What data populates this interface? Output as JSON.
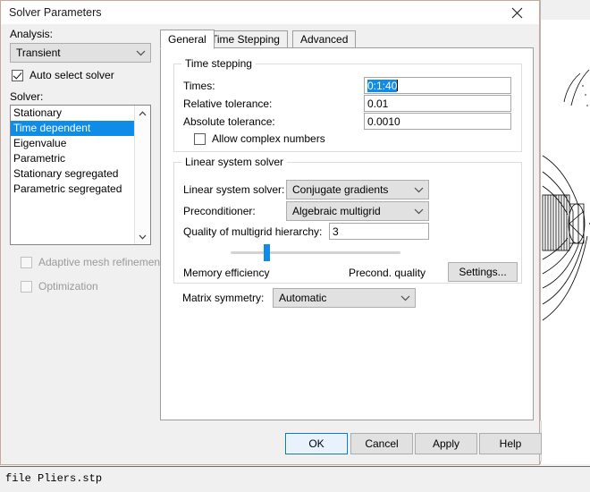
{
  "app": {
    "status_text": "file Pliers.stp"
  },
  "dialog": {
    "title": "Solver Parameters",
    "close_icon": "close-icon"
  },
  "left_pane": {
    "analysis_label": "Analysis:",
    "analysis_value": "Transient",
    "analysis_options": [
      "Transient"
    ],
    "auto_select_solver_label": "Auto select solver",
    "auto_select_solver_checked": true,
    "solver_label": "Solver:",
    "solver_items": [
      {
        "label": "Stationary",
        "selected": false
      },
      {
        "label": "Time dependent",
        "selected": true
      },
      {
        "label": "Eigenvalue",
        "selected": false
      },
      {
        "label": "Parametric",
        "selected": false
      },
      {
        "label": "Stationary segregated",
        "selected": false
      },
      {
        "label": "Parametric segregated",
        "selected": false
      }
    ],
    "adaptive_mesh_label": "Adaptive mesh refinement",
    "adaptive_mesh_checked": false,
    "adaptive_mesh_disabled": true,
    "optimization_label": "Optimization",
    "optimization_checked": false,
    "optimization_disabled": true,
    "scroll_up_icon": "chevron-up-icon",
    "scroll_down_icon": "chevron-down-icon"
  },
  "tabs": [
    {
      "label": "General",
      "active": true
    },
    {
      "label": "Time Stepping",
      "active": false
    },
    {
      "label": "Advanced",
      "active": false
    }
  ],
  "time_stepping": {
    "group_title": "Time stepping",
    "times_label": "Times:",
    "times_value": "0:1:40",
    "times_value_selected": true,
    "relative_tolerance_label": "Relative tolerance:",
    "relative_tolerance_value": "0.01",
    "absolute_tolerance_label": "Absolute tolerance:",
    "absolute_tolerance_value": "0.0010",
    "allow_complex_label": "Allow complex numbers",
    "allow_complex_checked": false
  },
  "linear_solver": {
    "group_title": "Linear system solver",
    "solver_label": "Linear system solver:",
    "solver_value": "Conjugate gradients",
    "preconditioner_label": "Preconditioner:",
    "preconditioner_value": "Algebraic multigrid",
    "quality_label": "Quality of multigrid hierarchy:",
    "quality_value": "3",
    "slider_left_label": "Memory efficiency",
    "slider_right_label": "Precond. quality",
    "slider_position_percent": 20,
    "settings_button": "Settings..."
  },
  "matrix": {
    "label": "Matrix symmetry:",
    "value": "Automatic"
  },
  "footer": {
    "ok": "OK",
    "cancel": "Cancel",
    "apply": "Apply",
    "help": "Help"
  },
  "colors": {
    "accent": "#0f8ce8",
    "dialog_border": "#c8a898",
    "default_button_border": "#0078d7"
  }
}
